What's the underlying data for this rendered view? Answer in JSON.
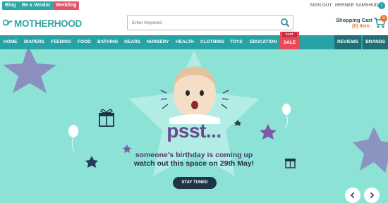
{
  "topbar": {
    "blog": "Blog",
    "vendor": "Be a Vendor",
    "wedding": "Wedding",
    "signout": "SIGN OUT",
    "user": "HERNEE SAMSHUDIN",
    "notifications": "1"
  },
  "header": {
    "logo": "MOTHERHOOD",
    "search_placeholder": "Enter Keyword",
    "cart_title": "Shopping Cart",
    "cart_items": "(0) Item",
    "cart_count": "0"
  },
  "nav": {
    "items": [
      "HOME",
      "DIAPERS",
      "FEEDING",
      "FOOD",
      "BATHING",
      "GEARS",
      "NURSERY",
      "HEALTH",
      "CLOTHING",
      "TOYS",
      "EDUCATION"
    ],
    "sale_tag": "FAST",
    "sale": "SALE",
    "reviews": "REVIEWS",
    "brands": "BRANDS"
  },
  "banner": {
    "headline": "psst...",
    "line1": "someone's birthday is coming up",
    "line2": "watch out this space on 29th May!",
    "cta": "STAY TUNED"
  },
  "colors": {
    "teal": "#27a3a6",
    "dark_teal": "#1e6f76",
    "banner_bg": "#8de2d6",
    "sale_red": "#e84b57",
    "purple": "#684a8d",
    "cart_orange": "#e8762c"
  }
}
